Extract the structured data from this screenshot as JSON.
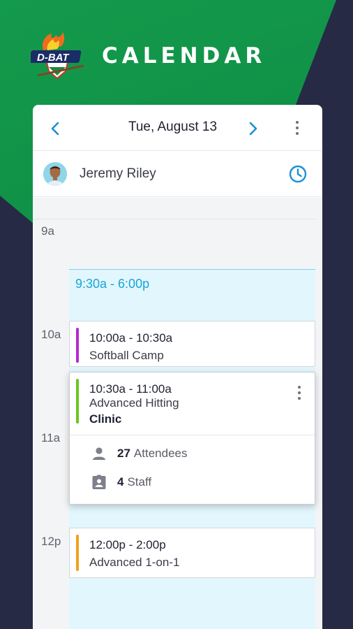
{
  "app": {
    "logo_text": "D-BAT",
    "title": "CALENDAR"
  },
  "date_bar": {
    "date": "Tue, August 13",
    "prev_icon": "chevron-left-icon",
    "next_icon": "chevron-right-icon",
    "more_icon": "more-vert-icon"
  },
  "user": {
    "name": "Jeremy Riley",
    "clock_icon": "clock-icon"
  },
  "schedule": {
    "hours": [
      "9a",
      "10a",
      "11a",
      "12p"
    ],
    "availability": "9:30a - 6:00p",
    "events": [
      {
        "time": "10:00a - 10:30a",
        "title": "Softball Camp",
        "color": "#b32bcf"
      },
      {
        "time": "10:30a - 11:00a",
        "title_line1": "Advanced Hitting",
        "title_line2": "Clinic",
        "color": "#6cc424",
        "attendees_count": "27",
        "attendees_label": "Attendees",
        "staff_count": "4",
        "staff_label": "Staff"
      },
      {
        "time": "12:00p - 2:00p",
        "title": "Advanced 1-on-1",
        "color": "#f0a21e"
      }
    ]
  },
  "colors": {
    "accent_blue": "#1aa4d8",
    "brand_green": "#0c8a43",
    "background_navy": "#262a44"
  }
}
